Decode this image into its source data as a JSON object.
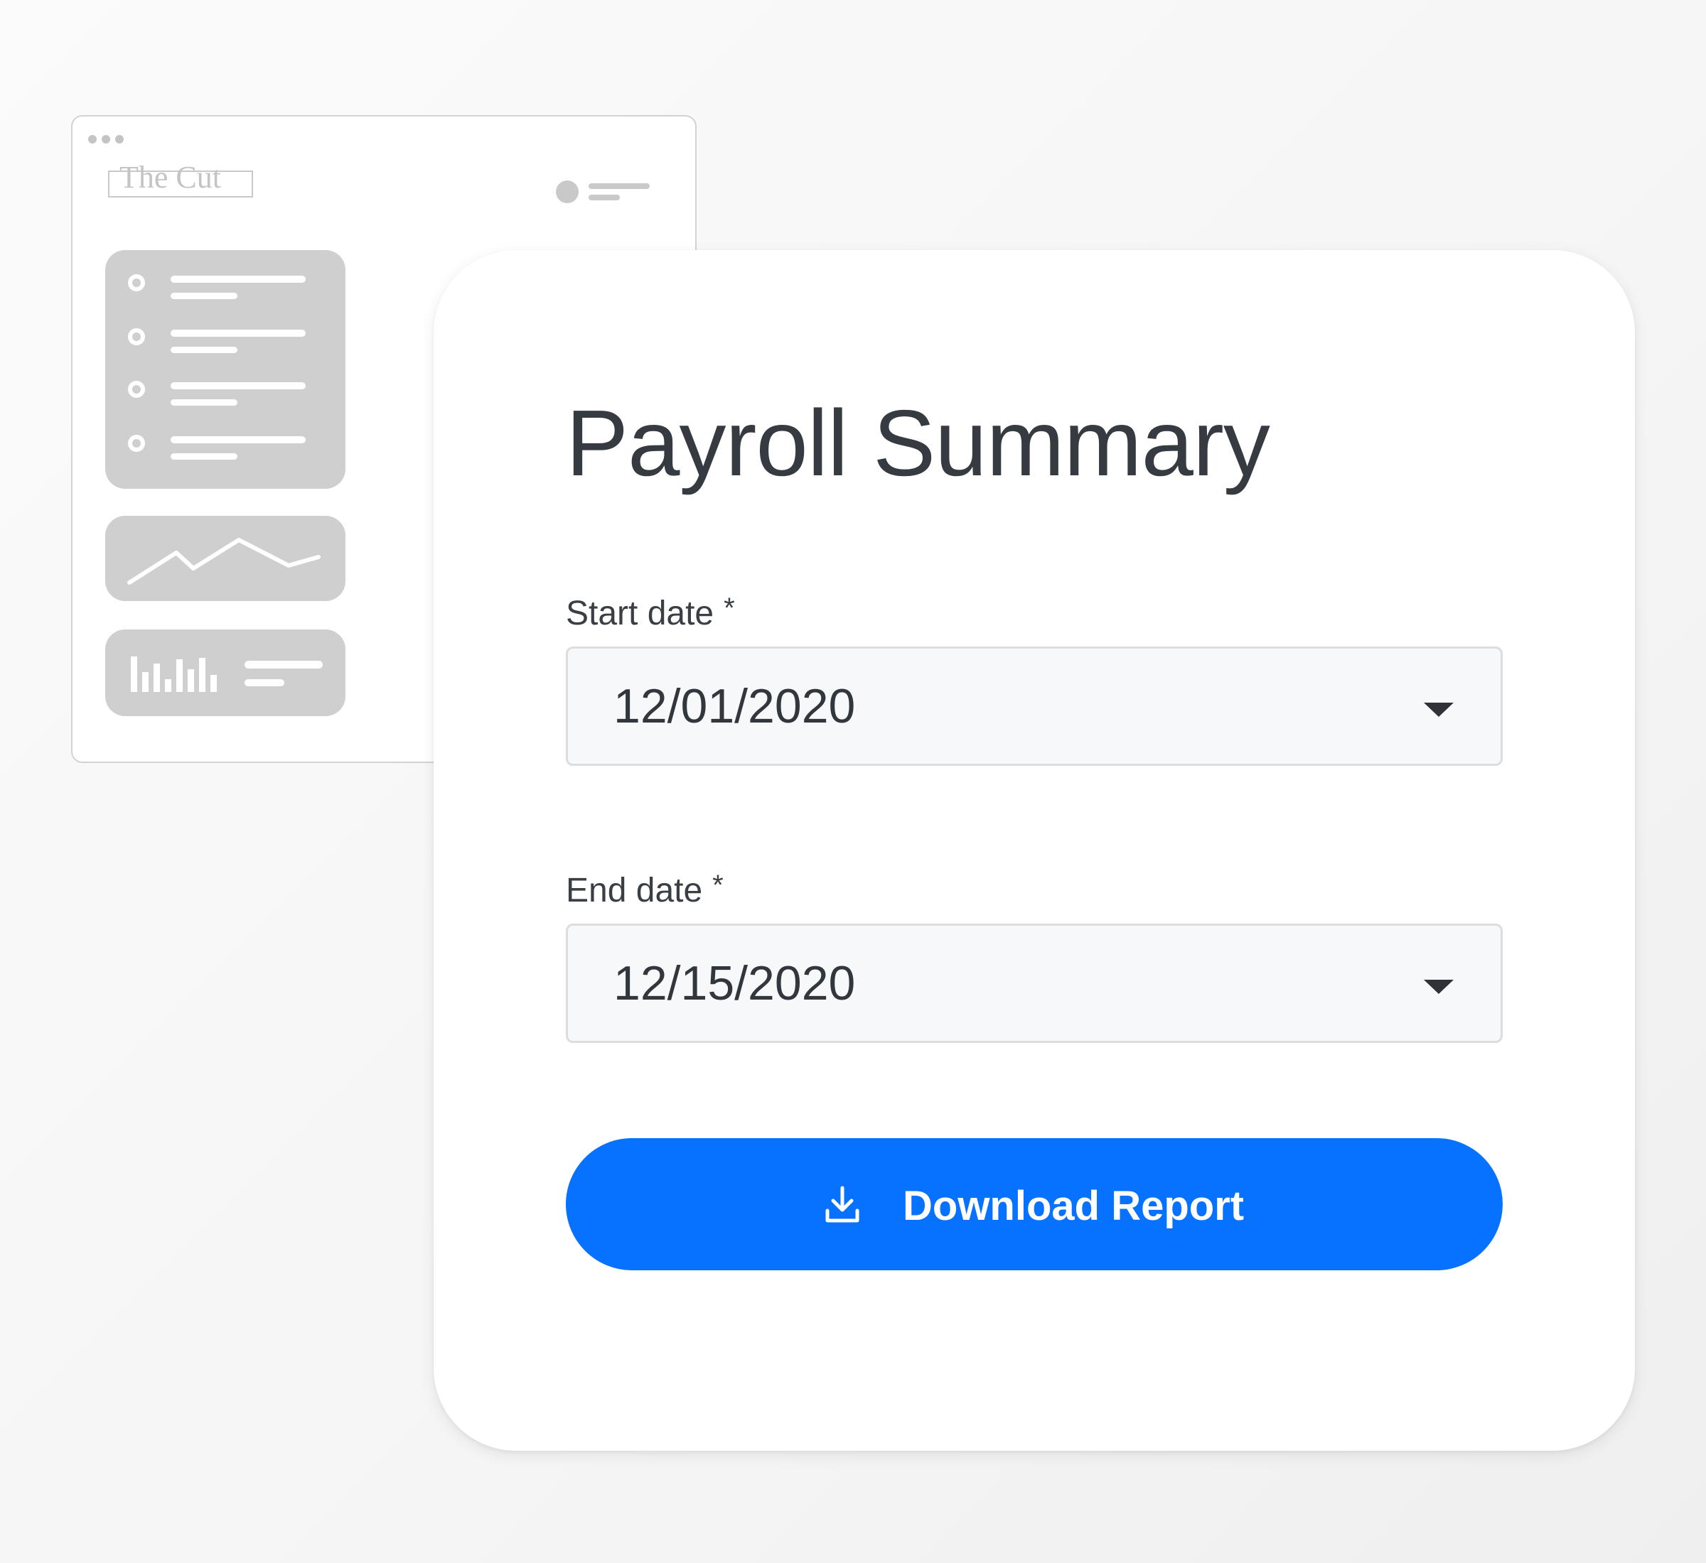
{
  "background_window": {
    "logo_text": "The Cut"
  },
  "payroll": {
    "title": "Payroll Summary",
    "start_date": {
      "label": "Start date",
      "required_mark": "*",
      "value": "12/01/2020"
    },
    "end_date": {
      "label": "End date",
      "required_mark": "*",
      "value": "12/15/2020"
    },
    "download_button": {
      "label": "Download Report",
      "icon": "download-icon"
    }
  },
  "colors": {
    "accent": "#0672ff",
    "title_text": "#363b41",
    "field_bg": "#f7f8f9",
    "field_border": "#dcdddf",
    "placeholder_gray": "#cfcfcf"
  }
}
